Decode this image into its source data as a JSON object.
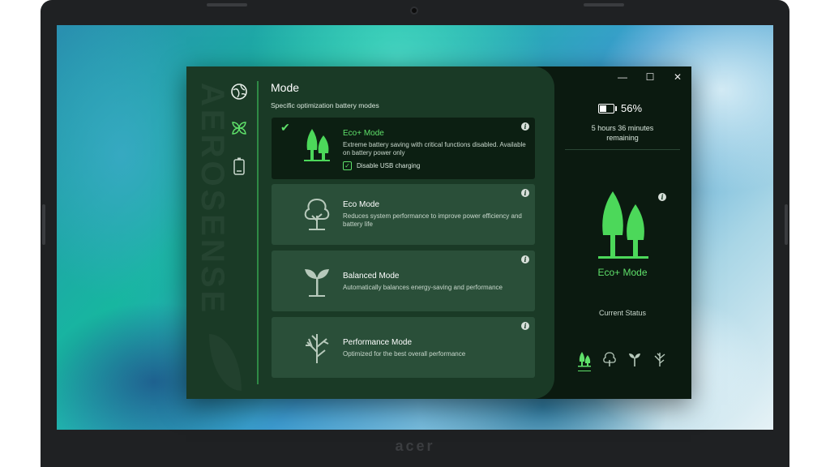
{
  "device": {
    "brand": "acer"
  },
  "app": {
    "wordmark": "AEROSENSE",
    "title": "Mode",
    "subtitle": "Specific optimization battery modes",
    "nav": [
      {
        "icon": "globe-icon"
      },
      {
        "icon": "leaves-icon"
      },
      {
        "icon": "battery-icon"
      }
    ],
    "modes": [
      {
        "name": "Eco+ Mode",
        "desc": "Extreme battery saving with critical functions disabled. Available on battery power only",
        "icon": "two-trees-icon",
        "selected": true,
        "usb_label": "Disable USB charging",
        "usb_checked": true
      },
      {
        "name": "Eco Mode",
        "desc": "Reduces system performance to improve power efficiency and battery life",
        "icon": "tree-icon",
        "selected": false
      },
      {
        "name": "Balanced Mode",
        "desc": "Automatically balances energy-saving and performance",
        "icon": "sprout-icon",
        "selected": false
      },
      {
        "name": "Performance Mode",
        "desc": "Optimized for the best overall performance",
        "icon": "bare-tree-icon",
        "selected": false
      }
    ],
    "info_glyph": "i",
    "window": {
      "minimize": "—",
      "maximize": "☐",
      "close": "✕"
    },
    "status": {
      "battery_percent": "56%",
      "battery_level": 0.56,
      "remaining_line1": "5 hours 36 minutes",
      "remaining_line2": "remaining",
      "mode": "Eco+ Mode",
      "label": "Current Status",
      "active_mode_index": 0
    },
    "colors": {
      "accent": "#5fe06a",
      "panel": "#1a3a26",
      "card": "#2a4f39",
      "selected_card": "#0c1f12"
    }
  }
}
